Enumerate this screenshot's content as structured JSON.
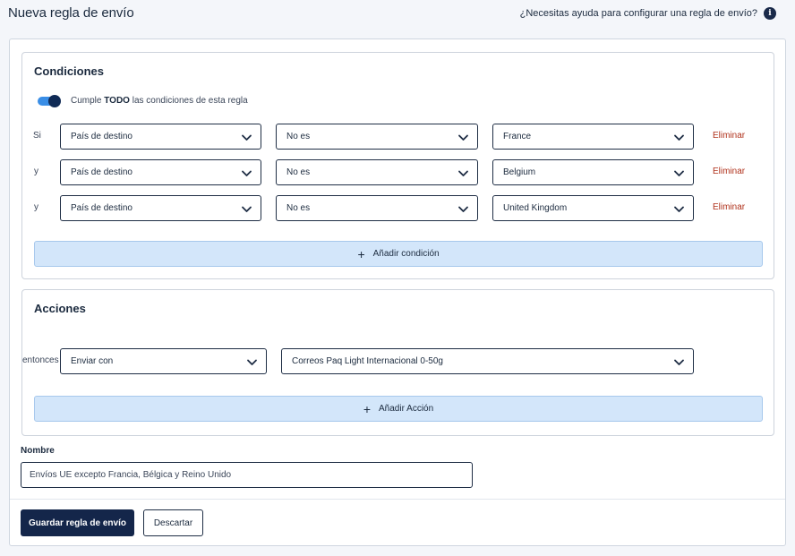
{
  "header": {
    "title": "Nueva regla de envío",
    "help_text": "¿Necesitas ayuda para configurar una regla de envío?",
    "help_icon": "info-icon"
  },
  "conditions": {
    "title": "Condiciones",
    "toggle_on": true,
    "toggle_pre": "Cumple ",
    "toggle_bold": "TODO",
    "toggle_post": " las condiciones de esta regla",
    "rows": [
      {
        "prefix": "Si",
        "field": "País de destino",
        "operator": "No es",
        "value": "France",
        "delete": "Eliminar"
      },
      {
        "prefix": "y",
        "field": "País de destino",
        "operator": "No es",
        "value": "Belgium",
        "delete": "Eliminar"
      },
      {
        "prefix": "y",
        "field": "País de destino",
        "operator": "No es",
        "value": "United Kingdom",
        "delete": "Eliminar"
      }
    ],
    "add_label": "Añadir condición"
  },
  "actions": {
    "title": "Acciones",
    "prefix": "entonces",
    "action": "Enviar con",
    "service": "Correos Paq Light Internacional 0-50g",
    "add_label": "Añadir Acción"
  },
  "name": {
    "label": "Nombre",
    "value": "Envíos UE excepto Francia, Bélgica y Reino Unido"
  },
  "footer": {
    "save_label": "Guardar regla de envío",
    "discard_label": "Descartar"
  },
  "colors": {
    "primary": "#14264a",
    "accent": "#3a8ee6",
    "danger": "#b0321c",
    "add_button_bg": "#d3e6fa"
  }
}
